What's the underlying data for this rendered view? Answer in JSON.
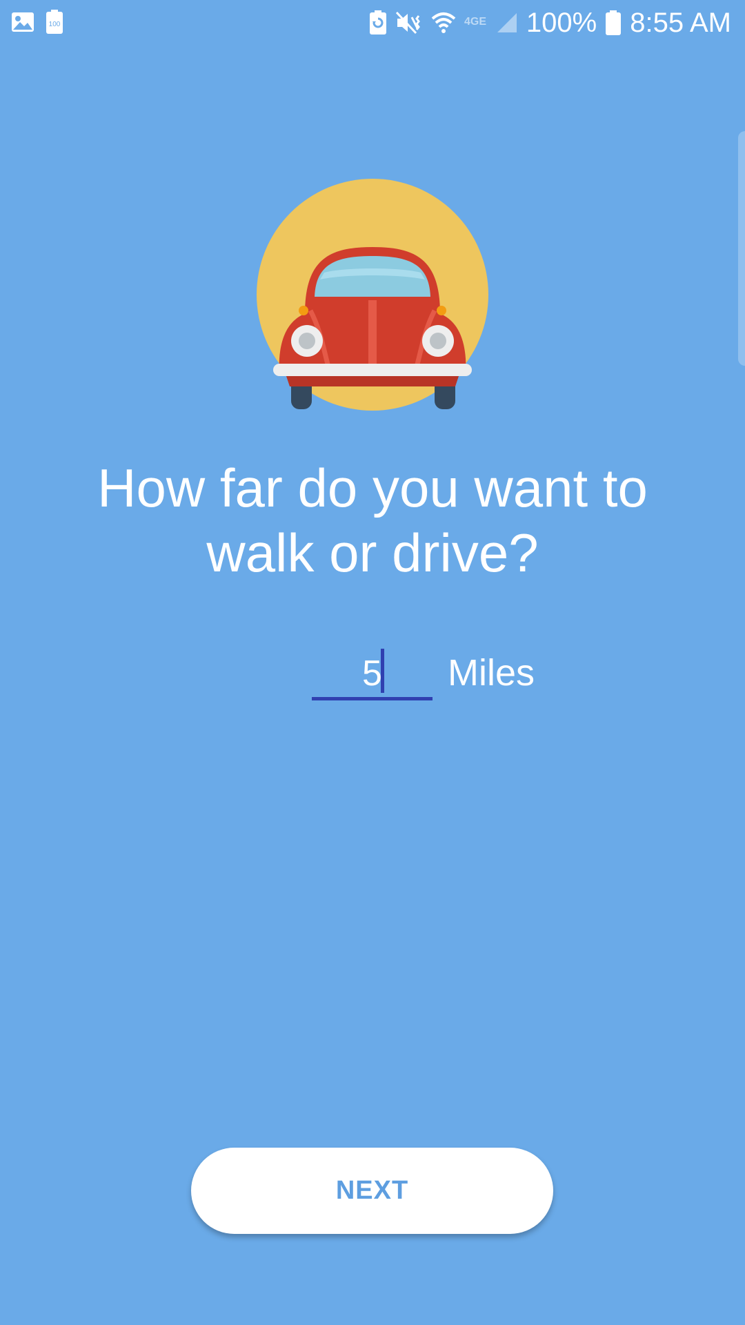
{
  "status_bar": {
    "left_icons": [
      "gallery-icon",
      "battery-100-icon"
    ],
    "right_icons": [
      "battery-saver-icon",
      "mute-vibrate-icon",
      "wifi-icon",
      "4g-icon",
      "signal-icon"
    ],
    "battery_percent": "100%",
    "time": "8:55 AM",
    "battery_mini_label": "100"
  },
  "illustration": {
    "icon": "car-icon",
    "colors": {
      "circle": "#eec65e",
      "body": "#d03d2c",
      "window": "#8ccbe0",
      "bumper": "#eeeeee",
      "tire": "#34495e"
    }
  },
  "question": {
    "line1": "How far do you want to",
    "line2": "walk or drive?"
  },
  "distance": {
    "value": "5",
    "unit": "Miles"
  },
  "next_button": {
    "label": "NEXT"
  },
  "colors": {
    "background": "#6aaae8",
    "accent": "#3040b0",
    "button_text": "#5e9ee0"
  }
}
